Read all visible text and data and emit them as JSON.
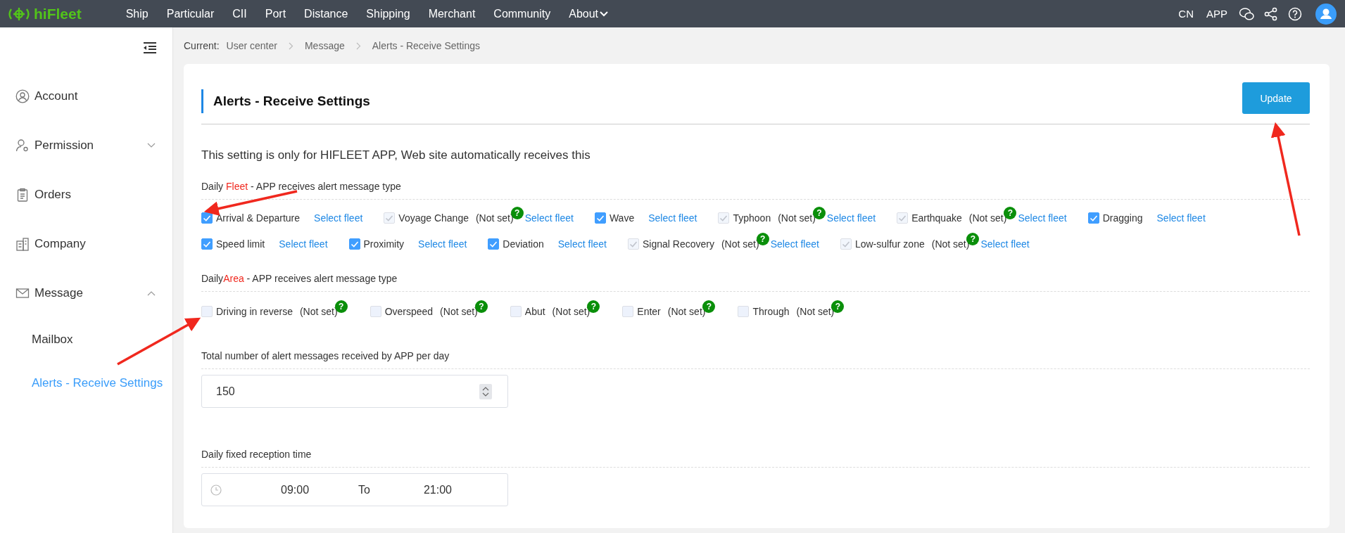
{
  "nav": {
    "logo": "hiFleet",
    "items": [
      {
        "label": "Ship",
        "dropdown": false
      },
      {
        "label": "Particular",
        "dropdown": false
      },
      {
        "label": "CII",
        "dropdown": false
      },
      {
        "label": "Port",
        "dropdown": false
      },
      {
        "label": "Distance",
        "dropdown": false
      },
      {
        "label": "Shipping",
        "dropdown": false
      },
      {
        "label": "Merchant",
        "dropdown": false
      },
      {
        "label": "Community",
        "dropdown": false
      },
      {
        "label": "About",
        "dropdown": true
      }
    ],
    "right": [
      "CN",
      "APP"
    ]
  },
  "sidebar": {
    "items": [
      {
        "label": "Account"
      },
      {
        "label": "Permission",
        "expanded": false
      },
      {
        "label": "Orders"
      },
      {
        "label": "Company"
      },
      {
        "label": "Message",
        "expanded": true,
        "children": [
          {
            "label": "Mailbox",
            "selected": false
          },
          {
            "label": "Alerts - Receive Settings",
            "selected": true
          }
        ]
      }
    ]
  },
  "breadcrumb": {
    "prefix": "Current:",
    "items": [
      "User center",
      "Message",
      "Alerts - Receive Settings"
    ]
  },
  "page": {
    "title": "Alerts - Receive Settings",
    "button": "Update",
    "notice": "This setting is only for HIFLEET APP, Web site automatically receives this"
  },
  "fleet": {
    "heading": {
      "prefix": "Daily ",
      "highlight": "Fleet",
      "suffix": " - APP receives alert message type"
    },
    "items": [
      {
        "label": "Arrival & Departure",
        "checked": true,
        "disabled": false,
        "link": "Select fleet"
      },
      {
        "label": "Voyage Change",
        "checked": true,
        "disabled": true,
        "note": "(Not set)",
        "link": "Select fleet"
      },
      {
        "label": "Wave",
        "checked": true,
        "disabled": false,
        "link": "Select fleet"
      },
      {
        "label": "Typhoon",
        "checked": true,
        "disabled": true,
        "note": "(Not set)",
        "link": "Select fleet"
      },
      {
        "label": "Earthquake",
        "checked": true,
        "disabled": true,
        "note": "(Not set)",
        "link": "Select fleet"
      },
      {
        "label": "Dragging",
        "checked": true,
        "disabled": false,
        "link": "Select fleet"
      },
      {
        "label": "Speed limit",
        "checked": true,
        "disabled": false,
        "link": "Select fleet"
      },
      {
        "label": "Proximity",
        "checked": true,
        "disabled": false,
        "link": "Select fleet"
      },
      {
        "label": "Deviation",
        "checked": true,
        "disabled": false,
        "link": "Select fleet"
      },
      {
        "label": "Signal Recovery",
        "checked": true,
        "disabled": true,
        "note": "(Not set)",
        "link": "Select fleet"
      },
      {
        "label": "Low-sulfur zone",
        "checked": true,
        "disabled": true,
        "note": "(Not set)",
        "link": "Select fleet"
      }
    ]
  },
  "area": {
    "heading": {
      "prefix": "Daily",
      "highlight": "Area",
      "suffix": " - APP receives alert message type"
    },
    "items": [
      {
        "label": "Driving in reverse",
        "checked": false,
        "note": "(Not set)"
      },
      {
        "label": "Overspeed",
        "checked": false,
        "note": "(Not set)"
      },
      {
        "label": "Abut",
        "checked": false,
        "note": "(Not set)"
      },
      {
        "label": "Enter",
        "checked": false,
        "note": "(Not set)"
      },
      {
        "label": "Through",
        "checked": false,
        "note": "(Not set)"
      }
    ]
  },
  "total": {
    "label": "Total number of alert messages received by APP per day",
    "value": "150"
  },
  "time": {
    "label": "Daily fixed reception time",
    "start": "09:00",
    "separator": "To",
    "end": "21:00"
  },
  "help_mark": "?"
}
